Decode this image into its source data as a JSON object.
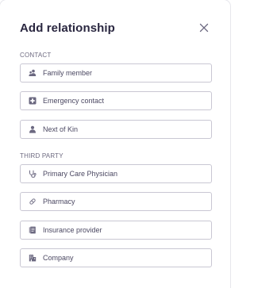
{
  "dialog": {
    "title": "Add relationship",
    "close_icon": "close-icon"
  },
  "sections": {
    "contact": {
      "label": "CONTACT",
      "items": [
        {
          "label": "Family member",
          "icon": "family-icon"
        },
        {
          "label": "Emergency contact",
          "icon": "medical-cross-icon"
        },
        {
          "label": "Next of Kin",
          "icon": "person-icon"
        }
      ]
    },
    "third_party": {
      "label": "THIRD PARTY",
      "items": [
        {
          "label": "Primary Care Physician",
          "icon": "stethoscope-icon"
        },
        {
          "label": "Pharmacy",
          "icon": "pill-icon"
        },
        {
          "label": "Insurance provider",
          "icon": "document-icon"
        },
        {
          "label": "Company",
          "icon": "building-icon"
        }
      ]
    }
  },
  "colors": {
    "text": "#2a2740",
    "muted": "#6d6a80",
    "border": "#c9c7d3",
    "icon": "#6b6880"
  }
}
